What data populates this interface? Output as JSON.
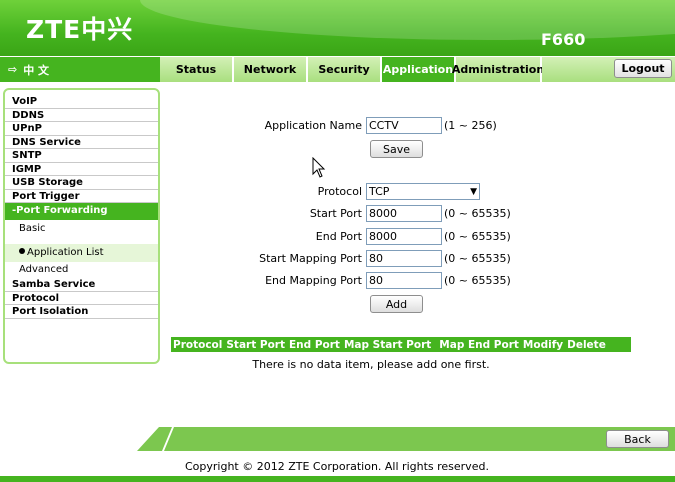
{
  "header": {
    "logo_text": "ZTE中兴",
    "model": "F660"
  },
  "langbar": {
    "arrow": "⇨",
    "label": "中 文"
  },
  "tabs": [
    {
      "label": "Status"
    },
    {
      "label": "Network"
    },
    {
      "label": "Security"
    },
    {
      "label": "Application"
    },
    {
      "label": "Administration"
    }
  ],
  "logout_label": "Logout",
  "sidebar": {
    "items": [
      "VoIP",
      "DDNS",
      "UPnP",
      "DNS Service",
      "SNTP",
      "IGMP",
      "USB Storage",
      "Port Trigger"
    ],
    "open_item": "-Port Forwarding",
    "subitems": [
      "Basic",
      "Application List",
      "Advanced"
    ],
    "more_items": [
      "Samba Service",
      "Protocol",
      "Port Isolation"
    ]
  },
  "form": {
    "app_name_label": "Application Name",
    "app_name_value": "CCTV",
    "app_name_range": "(1 ~ 256)",
    "save_label": "Save",
    "protocol_label": "Protocol",
    "protocol_value": "TCP",
    "start_port_label": "Start Port",
    "start_port_value": "8000",
    "end_port_label": "End Port",
    "end_port_value": "8000",
    "start_map_label": "Start Mapping Port",
    "start_map_value": "80",
    "end_map_label": "End Mapping Port",
    "end_map_value": "80",
    "port_range": "(0 ~ 65535)",
    "add_label": "Add"
  },
  "table": {
    "headers": [
      "Protocol",
      "Start Port",
      "End Port",
      "Map Start Port",
      "Map End Port",
      "Modify",
      "Delete"
    ],
    "empty_message": "There is no data item, please add one first."
  },
  "footer": {
    "back_label": "Back",
    "copyright": "Copyright © 2012 ZTE Corporation. All rights reserved."
  },
  "colors": {
    "brand_green": "#45b41f",
    "light_green": "#a9df7f"
  }
}
